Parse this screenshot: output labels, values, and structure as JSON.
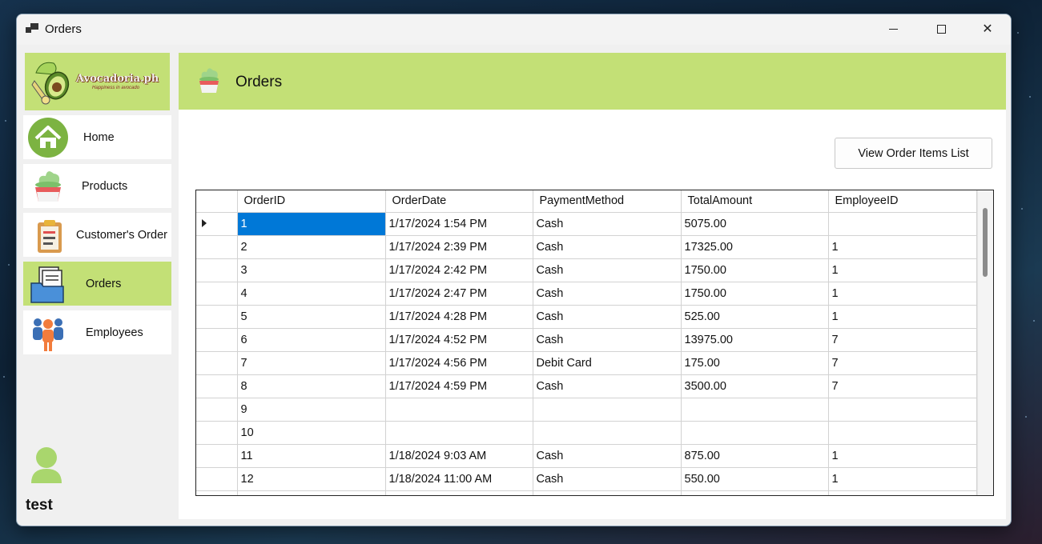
{
  "window": {
    "title": "Orders",
    "minimize": "—",
    "close": "✕"
  },
  "brand": {
    "name": "Avocadoria.ph",
    "tagline": "Happiness in avocado"
  },
  "sidebar": {
    "items": [
      {
        "label": "Home",
        "icon": "home-icon",
        "active": false
      },
      {
        "label": "Products",
        "icon": "ice-cream-icon",
        "active": false
      },
      {
        "label": "Customer's Order",
        "icon": "clipboard-icon",
        "active": false
      },
      {
        "label": "Orders",
        "icon": "folder-icon",
        "active": true
      },
      {
        "label": "Employees",
        "icon": "people-icon",
        "active": false
      }
    ]
  },
  "user": {
    "name": "test",
    "icon": "user-icon"
  },
  "header": {
    "title": "Orders",
    "icon": "ice-cream-icon"
  },
  "actions": {
    "view_items_label": "View Order Items List"
  },
  "grid": {
    "columns": [
      "OrderID",
      "OrderDate",
      "PaymentMethod",
      "TotalAmount",
      "EmployeeID"
    ],
    "selected_row": 0,
    "rows": [
      [
        "1",
        "1/17/2024 1:54 PM",
        "Cash",
        "5075.00",
        ""
      ],
      [
        "2",
        "1/17/2024 2:39 PM",
        "Cash",
        "17325.00",
        "1"
      ],
      [
        "3",
        "1/17/2024 2:42 PM",
        "Cash",
        "1750.00",
        "1"
      ],
      [
        "4",
        "1/17/2024 2:47 PM",
        "Cash",
        "1750.00",
        "1"
      ],
      [
        "5",
        "1/17/2024 4:28 PM",
        "Cash",
        "525.00",
        "1"
      ],
      [
        "6",
        "1/17/2024 4:52 PM",
        "Cash",
        "13975.00",
        "7"
      ],
      [
        "7",
        "1/17/2024 4:56 PM",
        "Debit Card",
        "175.00",
        "7"
      ],
      [
        "8",
        "1/17/2024 4:59 PM",
        "Cash",
        "3500.00",
        "7"
      ],
      [
        "9",
        "",
        "",
        "",
        ""
      ],
      [
        "10",
        "",
        "",
        "",
        ""
      ],
      [
        "11",
        "1/18/2024 9:03 AM",
        "Cash",
        "875.00",
        "1"
      ],
      [
        "12",
        "1/18/2024 11:00 AM",
        "Cash",
        "550.00",
        "1"
      ],
      [
        "",
        "",
        "",
        "",
        ""
      ]
    ]
  },
  "colors": {
    "accent": "#c3e076",
    "selection": "#0078d7"
  }
}
